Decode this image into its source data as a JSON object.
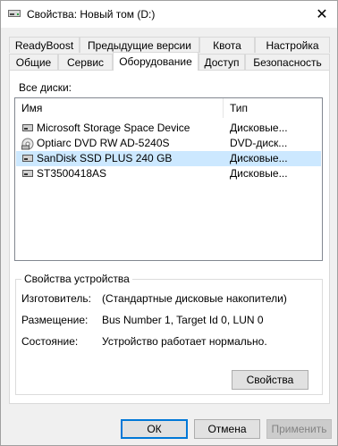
{
  "window": {
    "title": "Свойства: Новый том (D:)",
    "close_glyph": "✕"
  },
  "tabs": {
    "row_top": [
      "ReadyBoost",
      "Предыдущие версии",
      "Квота",
      "Настройка"
    ],
    "row_bottom": [
      "Общие",
      "Сервис",
      "Оборудование",
      "Доступ",
      "Безопасность"
    ],
    "active": "Оборудование"
  },
  "disks_label": "Все диски:",
  "list": {
    "columns": [
      "Имя",
      "Тип"
    ],
    "rows": [
      {
        "name": "Microsoft Storage Space Device",
        "type": "Дисковые...",
        "icon": "disk-drive-icon",
        "selected": false
      },
      {
        "name": "Optiarc DVD RW AD-5240S",
        "type": "DVD-диск...",
        "icon": "dvd-drive-icon",
        "selected": false
      },
      {
        "name": "SanDisk SSD PLUS 240 GB",
        "type": "Дисковые...",
        "icon": "disk-drive-icon",
        "selected": true
      },
      {
        "name": "ST3500418AS",
        "type": "Дисковые...",
        "icon": "disk-drive-icon",
        "selected": false
      }
    ]
  },
  "device_props": {
    "group_title": "Свойства устройства",
    "manufacturer_label": "Изготовитель:",
    "manufacturer_value": "(Стандартные дисковые накопители)",
    "location_label": "Размещение:",
    "location_value": "Bus Number 1, Target Id 0, LUN 0",
    "status_label": "Состояние:",
    "status_value": "Устройство работает нормально.",
    "properties_button": "Свойства"
  },
  "footer": {
    "ok": "ОК",
    "cancel": "Отмена",
    "apply": "Применить"
  },
  "colors": {
    "selection": "#cce8ff",
    "accent": "#0078d7"
  }
}
